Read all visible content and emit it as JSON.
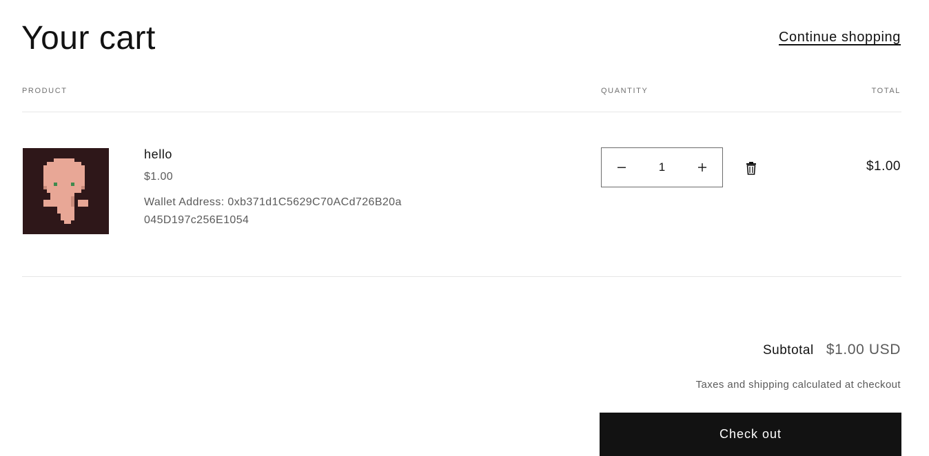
{
  "header": {
    "title": "Your cart",
    "continue_label": "Continue shopping"
  },
  "columns": {
    "product": "PRODUCT",
    "quantity": "QUANTITY",
    "total": "TOTAL"
  },
  "items": [
    {
      "name": "hello",
      "price": "$1.00",
      "wallet": "Wallet Address: 0xb371d1C5629C70ACd726B20a045D197c256E1054",
      "quantity": "1",
      "total": "$1.00",
      "image": "pixel-character-thumbnail"
    }
  ],
  "summary": {
    "subtotal_label": "Subtotal",
    "subtotal_value": "$1.00 USD",
    "taxes_note": "Taxes and shipping calculated at checkout",
    "checkout_label": "Check out"
  },
  "icons": {
    "decrease": "minus-icon",
    "increase": "plus-icon",
    "remove": "trash-icon"
  },
  "colors": {
    "text": "#121212",
    "muted": "#5a5a5a",
    "button_bg": "#121212",
    "thumb_bg": "#2e1719",
    "character": "#e8a796"
  }
}
